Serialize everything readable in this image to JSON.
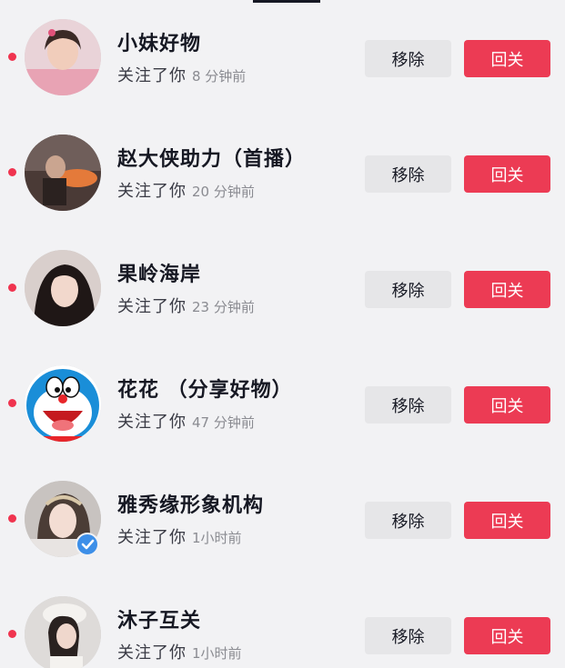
{
  "colors": {
    "background": "#f2f2f4",
    "accent_red": "#ec3b54",
    "unread_dot": "#f0344f",
    "remove_button_bg": "#e6e6e8",
    "verified_badge": "#3d8fe8"
  },
  "followers": [
    {
      "name": "小妹好物",
      "action_text": "关注了你",
      "time": "8 分钟前",
      "remove_label": "移除",
      "follow_back_label": "回关",
      "unread": true,
      "verified": false
    },
    {
      "name": "赵大侠助力（首播）",
      "action_text": "关注了你",
      "time": "20 分钟前",
      "remove_label": "移除",
      "follow_back_label": "回关",
      "unread": true,
      "verified": false
    },
    {
      "name": "果岭海岸",
      "action_text": "关注了你",
      "time": "23 分钟前",
      "remove_label": "移除",
      "follow_back_label": "回关",
      "unread": true,
      "verified": false
    },
    {
      "name": "花花 （分享好物）",
      "action_text": "关注了你",
      "time": "47 分钟前",
      "remove_label": "移除",
      "follow_back_label": "回关",
      "unread": true,
      "verified": false
    },
    {
      "name": "雅秀缘形象机构",
      "action_text": "关注了你",
      "time": "1小时前",
      "remove_label": "移除",
      "follow_back_label": "回关",
      "unread": true,
      "verified": true
    },
    {
      "name": "沐子互关",
      "action_text": "关注了你",
      "time": "1小时前",
      "remove_label": "移除",
      "follow_back_label": "回关",
      "unread": true,
      "verified": false
    }
  ]
}
